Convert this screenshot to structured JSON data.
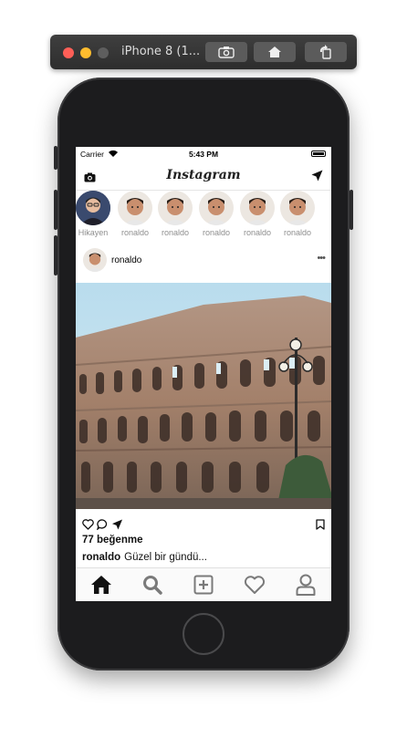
{
  "simulator": {
    "title": "iPhone 8 (1..."
  },
  "status_bar": {
    "carrier": "Carrier",
    "time": "5:43 PM"
  },
  "nav": {
    "logo": "Instagram"
  },
  "stories": [
    {
      "label": "Hikayen"
    },
    {
      "label": "ronaldo"
    },
    {
      "label": "ronaldo"
    },
    {
      "label": "ronaldo"
    },
    {
      "label": "ronaldo"
    },
    {
      "label": "ronaldo"
    }
  ],
  "post": {
    "username": "ronaldo",
    "more": "•••",
    "likes": "77 beğenme",
    "caption_user": "ronaldo",
    "caption_text": "Güzel bir gündü..."
  },
  "tabs": [
    "home-icon",
    "search-icon",
    "add-post-icon",
    "heart-icon",
    "profile-icon"
  ],
  "colors": {
    "sky": "#bfe0ef",
    "stone": "#a98973",
    "window_bg": "#2e2e2e"
  }
}
